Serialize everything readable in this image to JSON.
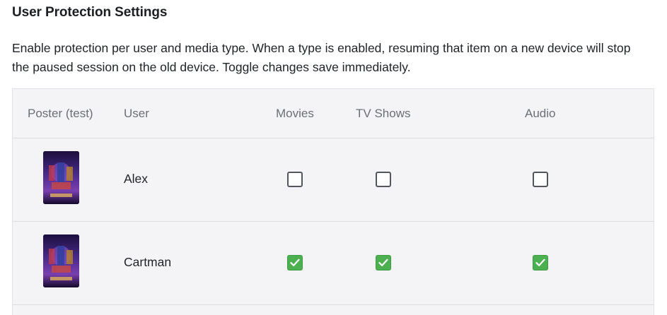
{
  "header": {
    "title": "User Protection Settings",
    "description": "Enable protection per user and media type. When a type is enabled, resuming that item on a new device will stop the paused session on the old device. Toggle changes save immediately."
  },
  "table": {
    "columns": {
      "poster": "Poster (test)",
      "user": "User",
      "movies": "Movies",
      "tv_shows": "TV Shows",
      "audio": "Audio"
    },
    "rows": [
      {
        "user": "Alex",
        "movies": false,
        "tv_shows": false,
        "audio": false,
        "poster_icon": "movie-poster-icon"
      },
      {
        "user": "Cartman",
        "movies": true,
        "tv_shows": true,
        "audio": true,
        "poster_icon": "movie-poster-icon"
      }
    ]
  },
  "colors": {
    "checked": "#4caf50",
    "unchecked_border": "#53575d",
    "table_bg": "#f4f4f6"
  }
}
